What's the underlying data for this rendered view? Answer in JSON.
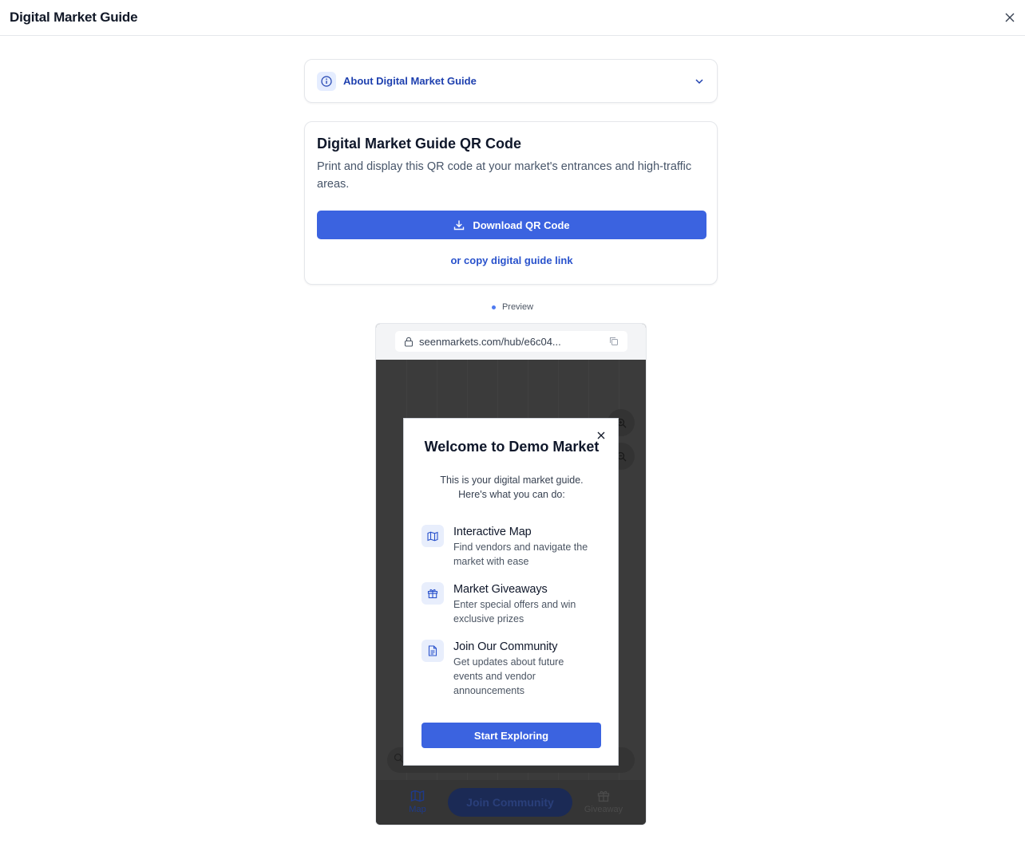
{
  "header": {
    "title": "Digital Market Guide",
    "close_icon": "close-icon"
  },
  "about": {
    "label": "About Digital Market Guide",
    "icon": "info-icon",
    "chevron": "chevron-down-icon"
  },
  "qr_card": {
    "title": "Digital Market Guide QR Code",
    "description": "Print and display this QR code at your market's entrances and high-traffic areas.",
    "download_label": "Download QR Code",
    "copy_link_label": "or copy digital guide link"
  },
  "preview": {
    "label": "Preview",
    "url": "seenmarkets.com/hub/e6c04...",
    "nav": {
      "map_label": "Map",
      "join_label": "Join Community",
      "giveaway_label": "Giveaway"
    }
  },
  "modal": {
    "title": "Welcome to Demo Market",
    "intro": "This is your digital market guide. Here's what you can do:",
    "features": [
      {
        "title": "Interactive Map",
        "description": "Find vendors and navigate the market with ease",
        "icon": "map-icon"
      },
      {
        "title": "Market Giveaways",
        "description": "Enter special offers and win exclusive prizes",
        "icon": "gift-icon"
      },
      {
        "title": "Join Our Community",
        "description": "Get updates about future events and vendor announcements",
        "icon": "document-icon"
      }
    ],
    "start_label": "Start Exploring"
  },
  "colors": {
    "primary": "#3b63e0",
    "link": "#2952cc",
    "accent_soft": "#e5edff"
  }
}
